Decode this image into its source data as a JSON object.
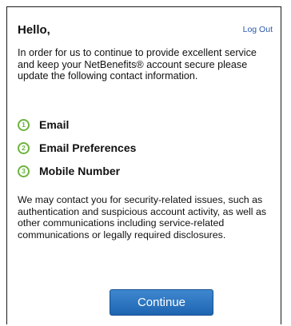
{
  "header": {
    "greeting": "Hello,",
    "logout_label": "Log Out"
  },
  "intro_text": "In order for us to continue to provide excellent service and keep your NetBenefits® account secure please update the following contact information.",
  "steps": [
    {
      "number": "1",
      "label": "Email"
    },
    {
      "number": "2",
      "label": "Email Preferences"
    },
    {
      "number": "3",
      "label": "Mobile Number"
    }
  ],
  "notice_text": "We may contact you for security-related issues, such as authentication and suspicious account activity, as well as other communications including service-related communications or legally required disclosures.",
  "continue_label": "Continue",
  "colors": {
    "step_accent": "#6db33f",
    "link": "#2a5aa8",
    "button": "#2e74c0"
  }
}
